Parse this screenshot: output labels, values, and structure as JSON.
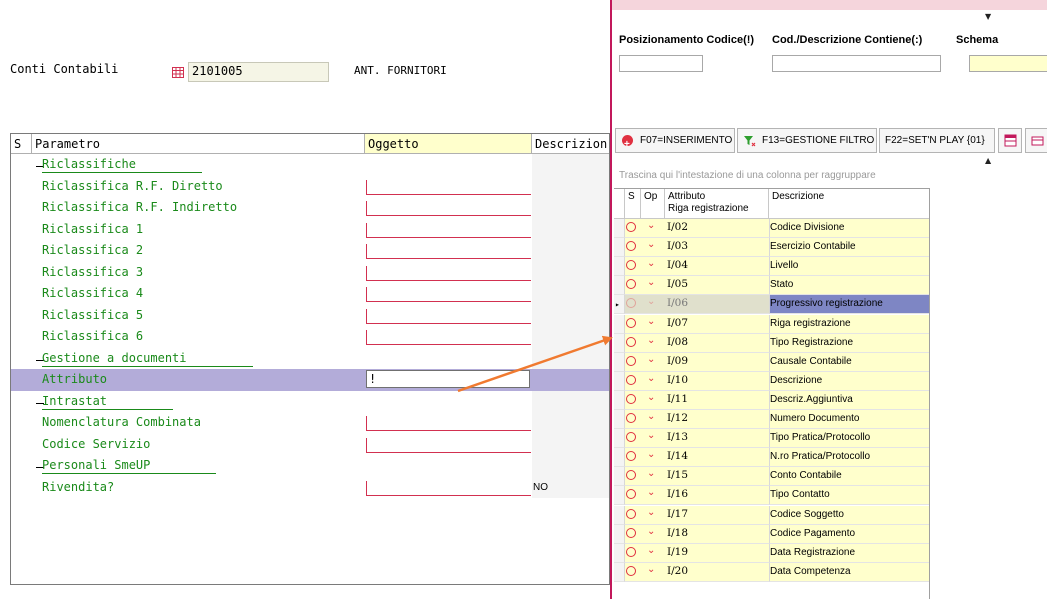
{
  "left": {
    "conti_label": "Conti Contabili",
    "conto_value": "2101005",
    "conto_desc": "ANT. FORNITORI",
    "grid_headers": {
      "s": "S",
      "parametro": "Parametro",
      "oggetto": "Oggetto",
      "descrizione": "Descrizion"
    },
    "rows": [
      {
        "label": "Riclassifiche",
        "group": true,
        "field": false
      },
      {
        "label": "Riclassifica R.F. Diretto",
        "group": false,
        "field": true
      },
      {
        "label": "Riclassifica R.F. Indiretto",
        "group": false,
        "field": true
      },
      {
        "label": "Riclassifica 1",
        "group": false,
        "field": true
      },
      {
        "label": "Riclassifica 2",
        "group": false,
        "field": true
      },
      {
        "label": "Riclassifica 3",
        "group": false,
        "field": true
      },
      {
        "label": "Riclassifica 4",
        "group": false,
        "field": true
      },
      {
        "label": "Riclassifica 5",
        "group": false,
        "field": true
      },
      {
        "label": "Riclassifica 6",
        "group": false,
        "field": true
      },
      {
        "label": "Gestione a documenti",
        "group": true,
        "field": false
      },
      {
        "label": "Attributo",
        "group": false,
        "field": false,
        "selected": true,
        "value": "!"
      },
      {
        "label": "Intrastat",
        "group": true,
        "field": false
      },
      {
        "label": "Nomenclatura Combinata",
        "group": false,
        "field": true
      },
      {
        "label": "Codice Servizio",
        "group": false,
        "field": true
      },
      {
        "label": "Personali SmeUP",
        "group": true,
        "field": false
      },
      {
        "label": "Rivendita?",
        "group": false,
        "field": true,
        "desc": "NO"
      }
    ]
  },
  "right": {
    "filters": {
      "pos_codice": "Posizionamento Codice(!)",
      "cod_desc": "Cod./Descrizione Contiene(:)",
      "schema": "Schema"
    },
    "toolbar": {
      "f07": "F07=INSERIMENTO",
      "f13": "F13=GESTIONE FILTRO",
      "f22": "F22=SET'N PLAY {01}"
    },
    "drag_hint": "Trascina qui l'intestazione di una colonna per raggruppare",
    "grid_headers": {
      "s": "S",
      "op": "Op",
      "attributo": "Attributo",
      "attributo_sub": "Riga registrazione",
      "descrizione": "Descrizione"
    },
    "rows": [
      {
        "code": "I/02",
        "desc": "Codice Divisione"
      },
      {
        "code": "I/03",
        "desc": "Esercizio Contabile"
      },
      {
        "code": "I/04",
        "desc": "Livello"
      },
      {
        "code": "I/05",
        "desc": "Stato"
      },
      {
        "code": "I/06",
        "desc": "Progressivo registrazione",
        "selected": true
      },
      {
        "code": "I/07",
        "desc": "Riga registrazione"
      },
      {
        "code": "I/08",
        "desc": "Tipo Registrazione"
      },
      {
        "code": "I/09",
        "desc": "Causale Contabile"
      },
      {
        "code": "I/10",
        "desc": "Descrizione"
      },
      {
        "code": "I/11",
        "desc": "Descriz.Aggiuntiva"
      },
      {
        "code": "I/12",
        "desc": "Numero Documento"
      },
      {
        "code": "I/13",
        "desc": "Tipo Pratica/Protocollo"
      },
      {
        "code": "I/14",
        "desc": "N.ro Pratica/Protocollo"
      },
      {
        "code": "I/15",
        "desc": "Conto Contabile"
      },
      {
        "code": "I/16",
        "desc": "Tipo Contatto"
      },
      {
        "code": "I/17",
        "desc": "Codice Soggetto"
      },
      {
        "code": "I/18",
        "desc": "Codice Pagamento"
      },
      {
        "code": "I/19",
        "desc": "Data Registrazione"
      },
      {
        "code": "I/20",
        "desc": "Data Competenza"
      }
    ]
  },
  "colors": {
    "green_text": "#1a8a1a",
    "selection": "#b3acd9",
    "right_selection": "#7e86c4",
    "yellow_cell": "#ffffcc",
    "accent_red": "#e03040",
    "arrow": "#f07a30"
  }
}
